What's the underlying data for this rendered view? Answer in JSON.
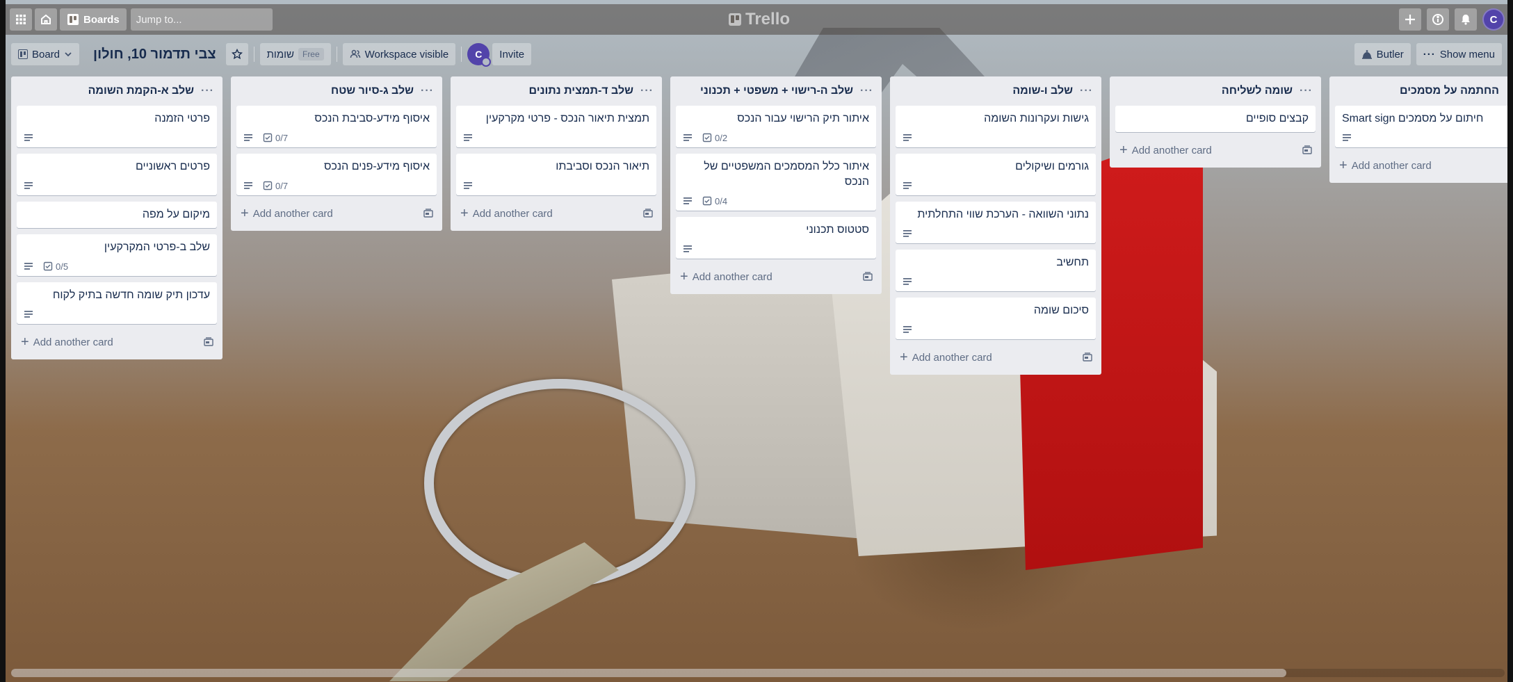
{
  "header": {
    "boards_label": "Boards",
    "search_placeholder": "Jump to...",
    "logo_text": "Trello",
    "user_initial": "C"
  },
  "board_header": {
    "view_label": "Board",
    "title": "צבי תדמור 10, חולון",
    "workspace_name": "שומות",
    "workspace_plan": "Free",
    "visibility_label": "Workspace visible",
    "member_initial": "C",
    "invite_label": "Invite",
    "butler_label": "Butler",
    "show_menu_label": "Show menu"
  },
  "add_card_label": "Add another card",
  "lists": [
    {
      "title": "שלב א-הקמת השומה",
      "cards": [
        {
          "title": "פרטי הזמנה",
          "description": true
        },
        {
          "title": "פרטים ראשוניים",
          "description": true
        },
        {
          "title": "מיקום על מפה",
          "description": false
        },
        {
          "title": "שלב ב-פרטי המקרקעין",
          "description": true,
          "checklist": "0/5"
        },
        {
          "title": "עדכון תיק שומה חדשה בתיק לקוח",
          "description": true
        }
      ]
    },
    {
      "title": "שלב ג-סיור שטח",
      "cards": [
        {
          "title": "איסוף מידע-סביבת הנכס",
          "description": true,
          "checklist": "0/7"
        },
        {
          "title": "איסוף מידע-פנים הנכס",
          "description": true,
          "checklist": "0/7"
        }
      ]
    },
    {
      "title": "שלב ד-תמצית נתונים",
      "cards": [
        {
          "title": "תמצית תיאור הנכס - פרטי מקרקעין",
          "description": true
        },
        {
          "title": "תיאור הנכס וסביבתו",
          "description": true
        }
      ]
    },
    {
      "title": "שלב ה-רישוי + משפטי + תכנוני",
      "cards": [
        {
          "title": "איתור תיק הרישוי עבור הנכס",
          "description": true,
          "checklist": "0/2"
        },
        {
          "title": "איתור כלל המסמכים המשפטיים של הנכס",
          "description": true,
          "checklist": "0/4"
        },
        {
          "title": "סטטוס תכנוני",
          "description": true
        }
      ]
    },
    {
      "title": "שלב ו-שומה",
      "cards": [
        {
          "title": "גישות ועקרונות השומה",
          "description": true
        },
        {
          "title": "גורמים ושיקולים",
          "description": true
        },
        {
          "title": "נתוני השוואה - הערכת שווי התחלתית",
          "description": true
        },
        {
          "title": "תחשיב",
          "description": true
        },
        {
          "title": "סיכום שומה",
          "description": true
        }
      ]
    },
    {
      "title": "שומה לשליחה",
      "cards": [
        {
          "title": "קבצים סופיים",
          "description": false
        }
      ]
    },
    {
      "title": "החתמה על מסמכים",
      "cards": [
        {
          "title": "חיתום על מסמכים Smart sign",
          "description": true
        }
      ]
    }
  ]
}
